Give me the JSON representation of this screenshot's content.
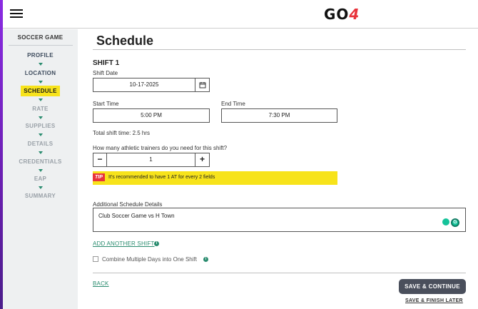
{
  "header": {
    "logo_main": "GO",
    "logo_accent": "4"
  },
  "sidebar": {
    "title": "SOCCER GAME",
    "steps": [
      {
        "label": "PROFILE",
        "state": "done"
      },
      {
        "label": "LOCATION",
        "state": "done"
      },
      {
        "label": "SCHEDULE",
        "state": "active"
      },
      {
        "label": "RATE",
        "state": "todo"
      },
      {
        "label": "SUPPLIES",
        "state": "todo"
      },
      {
        "label": "DETAILS",
        "state": "todo"
      },
      {
        "label": "CREDENTIALS",
        "state": "todo"
      },
      {
        "label": "EAP",
        "state": "todo"
      },
      {
        "label": "SUMMARY",
        "state": "todo"
      }
    ]
  },
  "main": {
    "title": "Schedule",
    "shift_heading": "SHIFT 1",
    "shift_date_label": "Shift Date",
    "shift_date_value": "10-17-2025",
    "start_time_label": "Start Time",
    "start_time_value": "5:00 PM",
    "end_time_label": "End Time",
    "end_time_value": "7:30 PM",
    "total_shift_time": "Total shift time: 2.5 hrs",
    "trainers_question": "How many athletic trainers do you need for this shift?",
    "trainers_count": "1",
    "stepper_minus": "−",
    "stepper_plus": "+",
    "tip_badge": "TIP",
    "tip_text": "It's recommended to have 1 AT for every 2 fields",
    "details_label": "Additional Schedule Details",
    "details_value": "Club Soccer Game vs H Town",
    "add_shift_link": "ADD ANOTHER SHIFT",
    "combine_label": "Combine Multiple Days into One Shift",
    "back_link": "BACK",
    "save_continue": "SAVE & CONTINUE",
    "save_finish": "SAVE & FINISH LATER"
  },
  "colors": {
    "accent_yellow": "#f7e31b",
    "accent_green": "#2a8c6f",
    "tip_red": "#e8333b",
    "button_dark": "#4a4f5c"
  }
}
